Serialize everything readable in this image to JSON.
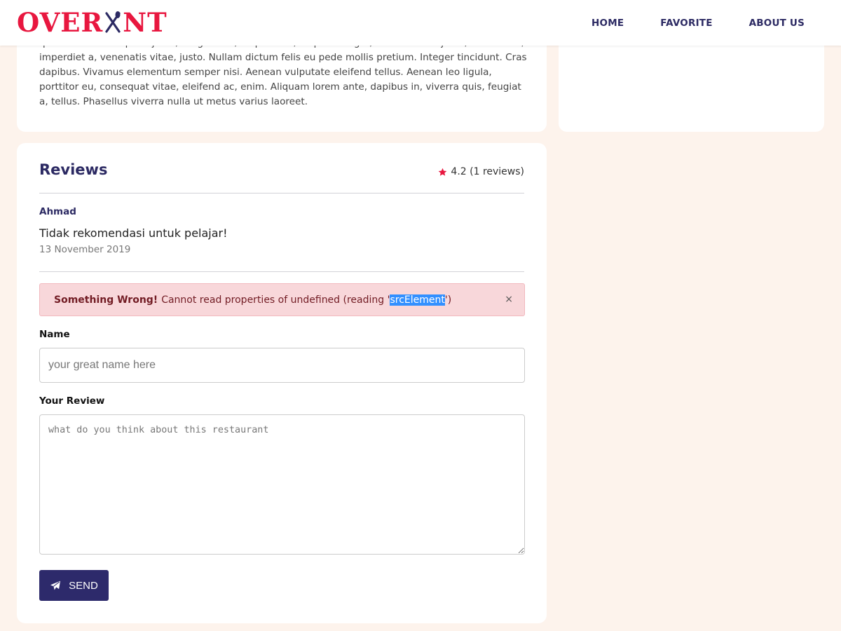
{
  "header": {
    "logo_left": "OVER",
    "logo_right": "NT",
    "nav": [
      "HOME",
      "FAVORITE",
      "ABOUT US"
    ]
  },
  "description": {
    "text": "quis enim. Donec pede justo, fringilla vel, aliquet nec, vulputate eget, arcu. In enim justo, rhoncus ut, imperdiet a, venenatis vitae, justo. Nullam dictum felis eu pede mollis pretium. Integer tincidunt. Cras dapibus. Vivamus elementum semper nisi. Aenean vulputate eleifend tellus. Aenean leo ligula, porttitor eu, consequat vitae, eleifend ac, enim. Aliquam lorem ante, dapibus in, viverra quis, feugiat a, tellus. Phasellus viverra nulla ut metus varius laoreet."
  },
  "reviews": {
    "title": "Reviews",
    "rating": "4.2 (1 reviews)",
    "items": [
      {
        "name": "Ahmad",
        "text": "Tidak rekomendasi untuk pelajar!",
        "date": "13 November 2019"
      }
    ]
  },
  "alert": {
    "title": "Something Wrong!",
    "message_before": "Cannot read properties of undefined (reading '",
    "message_highlight": "srcElement",
    "message_after": "')",
    "close": "×"
  },
  "form": {
    "name_label": "Name",
    "name_placeholder": "your great name here",
    "name_value": "",
    "review_label": "Your Review",
    "review_placeholder": "what do you think about this restaurant",
    "review_value": "",
    "send_label": "SEND"
  },
  "colors": {
    "brand": "#e8173f",
    "navy": "#2c2a63",
    "background": "#fdf3ec",
    "alert_bg": "#f8d7da"
  },
  "icons": [
    "fork-knife-icon",
    "star-icon",
    "paper-plane-icon",
    "close-icon"
  ]
}
